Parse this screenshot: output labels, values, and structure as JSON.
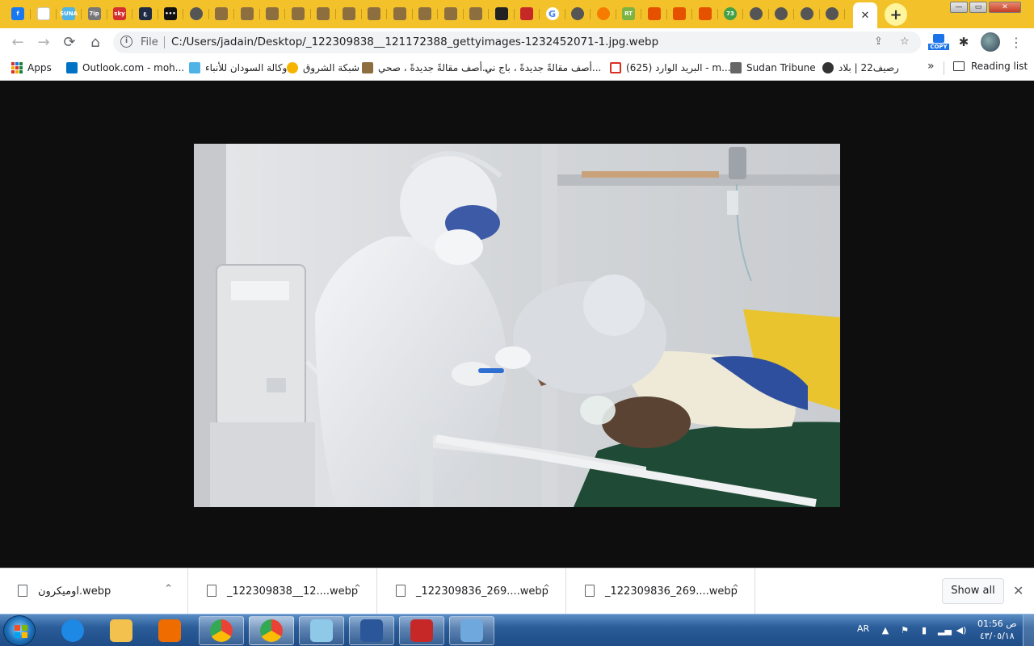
{
  "browser": {
    "tabs": [
      {
        "icon": "facebook-icon",
        "label": "f",
        "color": "#1877f2"
      },
      {
        "icon": "blank-icon",
        "label": "",
        "color": "#ffffff"
      },
      {
        "icon": "suna-icon",
        "label": "SUNA",
        "color": "#4fb3e6"
      },
      {
        "icon": "news-icon",
        "label": "7ip",
        "color": "#777777"
      },
      {
        "icon": "sky-icon",
        "label": "sky",
        "color": "#d32f2f"
      },
      {
        "icon": "arabiya-icon",
        "label": "ع",
        "color": "#1f2a44"
      },
      {
        "icon": "dots-icon",
        "label": "•••",
        "color": "#111111"
      },
      {
        "icon": "chrome-icon",
        "label": "",
        "color": "#555555"
      },
      {
        "icon": "sudan-icon",
        "label": "",
        "color": "#8d6e3f"
      },
      {
        "icon": "sudan-icon",
        "label": "",
        "color": "#8d6e3f"
      },
      {
        "icon": "sudan-icon",
        "label": "",
        "color": "#8d6e3f"
      },
      {
        "icon": "sudan-icon",
        "label": "",
        "color": "#8d6e3f"
      },
      {
        "icon": "sudan-icon",
        "label": "",
        "color": "#8d6e3f"
      },
      {
        "icon": "sudan-icon",
        "label": "",
        "color": "#8d6e3f"
      },
      {
        "icon": "sudan-icon",
        "label": "",
        "color": "#8d6e3f"
      },
      {
        "icon": "sudan-icon",
        "label": "",
        "color": "#8d6e3f"
      },
      {
        "icon": "sudan-icon",
        "label": "",
        "color": "#8d6e3f"
      },
      {
        "icon": "sudan-icon",
        "label": "",
        "color": "#8d6e3f"
      },
      {
        "icon": "sudan-icon",
        "label": "",
        "color": "#8d6e3f"
      },
      {
        "icon": "bag-icon",
        "label": "",
        "color": "#222222"
      },
      {
        "icon": "video-icon",
        "label": "",
        "color": "#c62828"
      },
      {
        "icon": "google-icon",
        "label": "G",
        "color": "#4285f4"
      },
      {
        "icon": "globe-icon",
        "label": "",
        "color": "#555555"
      },
      {
        "icon": "orange-icon",
        "label": "",
        "color": "#f57c00"
      },
      {
        "icon": "rt-icon",
        "label": "RT",
        "color": "#7cb342"
      },
      {
        "icon": "news-icon",
        "label": "",
        "color": "#e65100"
      },
      {
        "icon": "news-icon",
        "label": "",
        "color": "#e65100"
      },
      {
        "icon": "news-icon",
        "label": "",
        "color": "#e65100"
      },
      {
        "icon": "badge-icon",
        "label": "73",
        "color": "#43a047"
      },
      {
        "icon": "chrome-icon",
        "label": "",
        "color": "#555555"
      },
      {
        "icon": "chrome-icon",
        "label": "",
        "color": "#555555"
      },
      {
        "icon": "chrome-icon",
        "label": "",
        "color": "#555555"
      },
      {
        "icon": "globe-icon",
        "label": "",
        "color": "#555555"
      }
    ],
    "address": {
      "file_label": "File",
      "url": "C:/Users/jadain/Desktop/_122309838__121172388_gettyimages-1232452071-1.jpg.webp"
    },
    "bookmarks": [
      {
        "icon": "apps-icon",
        "label": "Apps"
      },
      {
        "icon": "outlook-icon",
        "label": "Outlook.com - moh...",
        "color": "#0072c6"
      },
      {
        "icon": "suna-icon",
        "label": "وكالة السودان للأنباء",
        "color": "#4fb3e6"
      },
      {
        "icon": "shorouk-icon",
        "label": "شبكة الشروق",
        "color": "#f6b400"
      },
      {
        "icon": "sudan-icon",
        "label": "أصف مقالةً جديدةً ، صحي...",
        "color": "#8d6e3f"
      },
      {
        "icon": "blank-icon",
        "label": "أصف مقالةً جديدةً ، باج ني...",
        "color": ""
      },
      {
        "icon": "gmail-icon",
        "label": "البريد الوارد (625) - m...",
        "color": "#d93025"
      },
      {
        "icon": "tribune-icon",
        "label": "Sudan Tribune",
        "color": "#666666"
      },
      {
        "icon": "raseef-icon",
        "label": "رصيف22 | بلاد",
        "color": "#333333"
      }
    ],
    "more_bookmarks": "»",
    "reading_list": "Reading list"
  },
  "viewer": {
    "image_file": "_122309838__121172388_gettyimages-1232452071-1.jpg.webp"
  },
  "downloads": {
    "items": [
      {
        "name": "اوميكرون.webp"
      },
      {
        "name": "_122309838__12....webp"
      },
      {
        "name": "_122309836_269....webp"
      },
      {
        "name": "_122309836_269....webp"
      }
    ],
    "show_all": "Show all"
  },
  "taskbar": {
    "apps": [
      {
        "name": "internet-explorer",
        "color": "#1e88e5"
      },
      {
        "name": "file-explorer",
        "color": "#f2c14e"
      },
      {
        "name": "media-player",
        "color": "#ef6c00"
      },
      {
        "name": "chrome",
        "color": "#34a853"
      },
      {
        "name": "chrome-active",
        "color": "#34a853"
      },
      {
        "name": "notepad",
        "color": "#8ec9e8"
      },
      {
        "name": "word",
        "color": "#2b579a"
      },
      {
        "name": "flashcard",
        "color": "#c62828"
      },
      {
        "name": "paint",
        "color": "#6fa8dc"
      }
    ],
    "language": "AR",
    "time": "01:56 ص",
    "date": "٤٣/٠٥/١٨"
  }
}
